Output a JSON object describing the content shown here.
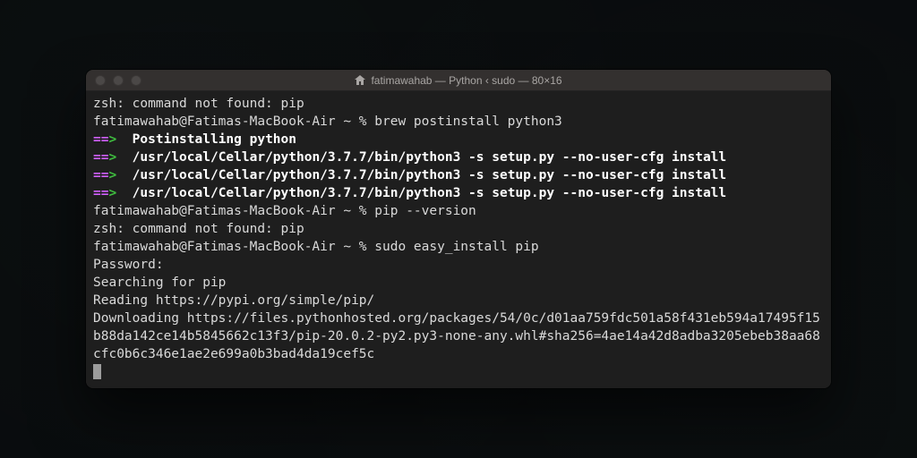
{
  "window": {
    "title": "fatimawahab — Python ‹ sudo — 80×16"
  },
  "terminal": {
    "lines": [
      {
        "segments": [
          {
            "text": "zsh: command not found: pip"
          }
        ]
      },
      {
        "segments": [
          {
            "text": "fatimawahab@Fatimas-MacBook-Air ~ % brew postinstall python3"
          }
        ]
      },
      {
        "segments": [
          {
            "text": "==",
            "cls": "purple"
          },
          {
            "text": ">",
            "cls": "arrow-green"
          },
          {
            "text": "  "
          },
          {
            "text": "Postinstalling python",
            "cls": "bold"
          }
        ]
      },
      {
        "segments": [
          {
            "text": "==",
            "cls": "purple"
          },
          {
            "text": ">",
            "cls": "arrow-green"
          },
          {
            "text": "  "
          },
          {
            "text": "/usr/local/Cellar/python/3.7.7/bin/python3 -s setup.py --no-user-cfg install",
            "cls": "bold"
          }
        ]
      },
      {
        "segments": [
          {
            "text": "==",
            "cls": "purple"
          },
          {
            "text": ">",
            "cls": "arrow-green"
          },
          {
            "text": "  "
          },
          {
            "text": "/usr/local/Cellar/python/3.7.7/bin/python3 -s setup.py --no-user-cfg install",
            "cls": "bold"
          }
        ]
      },
      {
        "segments": [
          {
            "text": "==",
            "cls": "purple"
          },
          {
            "text": ">",
            "cls": "arrow-green"
          },
          {
            "text": "  "
          },
          {
            "text": "/usr/local/Cellar/python/3.7.7/bin/python3 -s setup.py --no-user-cfg install",
            "cls": "bold"
          }
        ]
      },
      {
        "segments": [
          {
            "text": "fatimawahab@Fatimas-MacBook-Air ~ % pip --version"
          }
        ]
      },
      {
        "segments": [
          {
            "text": "zsh: command not found: pip"
          }
        ]
      },
      {
        "segments": [
          {
            "text": "fatimawahab@Fatimas-MacBook-Air ~ % sudo easy_install pip"
          }
        ]
      },
      {
        "segments": [
          {
            "text": "Password:"
          }
        ]
      },
      {
        "segments": [
          {
            "text": "Searching for pip"
          }
        ]
      },
      {
        "segments": [
          {
            "text": "Reading https://pypi.org/simple/pip/"
          }
        ]
      },
      {
        "segments": [
          {
            "text": "Downloading https://files.pythonhosted.org/packages/54/0c/d01aa759fdc501a58f431eb594a17495f15b88da142ce14b5845662c13f3/pip-20.0.2-py2.py3-none-any.whl#sha256=4ae14a42d8adba3205ebeb38aa68cfc0b6c346e1ae2e699a0b3bad4da19cef5c"
          }
        ]
      }
    ]
  }
}
